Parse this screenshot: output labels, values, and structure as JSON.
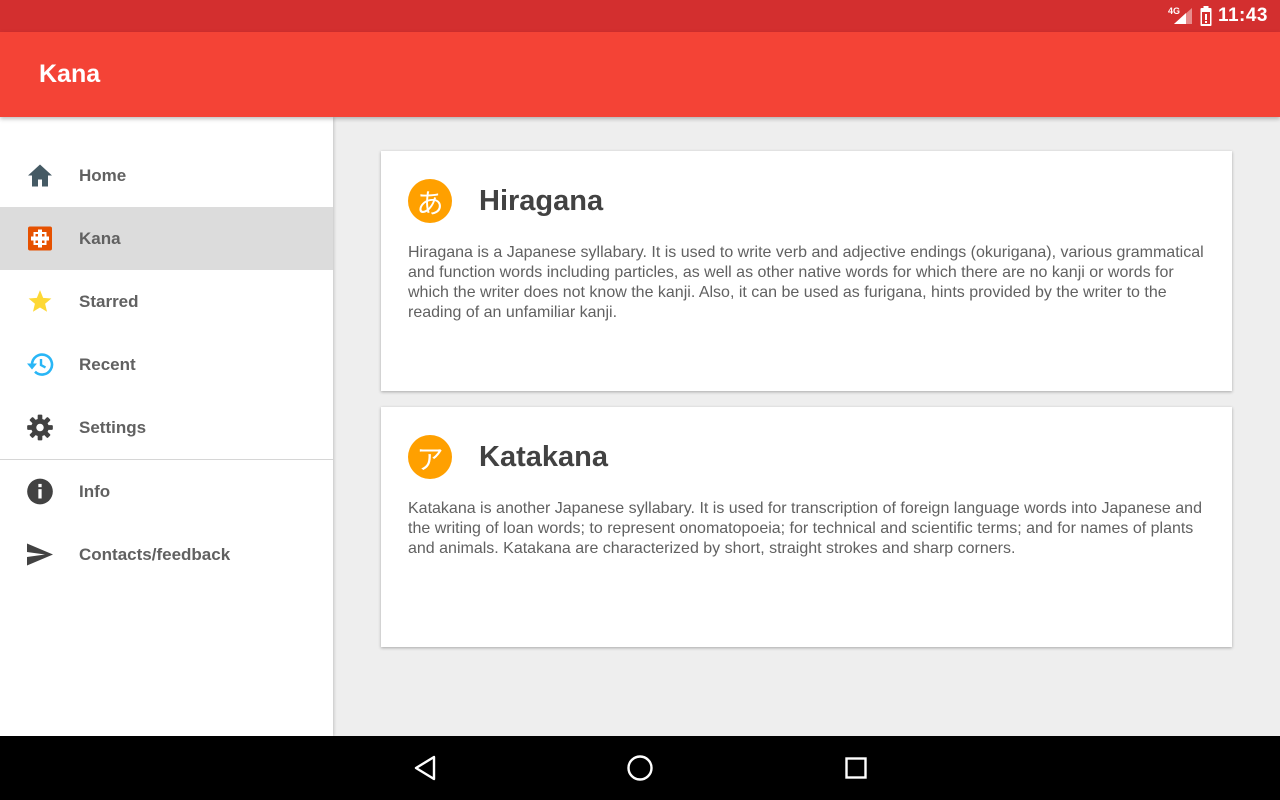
{
  "status_bar": {
    "network": "4G",
    "time": "11:43",
    "icons": [
      "signal-icon",
      "battery-icon"
    ]
  },
  "app_bar": {
    "title": "Kana"
  },
  "drawer": {
    "items": [
      {
        "label": "Home",
        "icon": "home-icon",
        "selected": false
      },
      {
        "label": "Kana",
        "icon": "kana-icon",
        "selected": true
      },
      {
        "label": "Starred",
        "icon": "star-icon",
        "selected": false
      },
      {
        "label": "Recent",
        "icon": "history-icon",
        "selected": false
      },
      {
        "label": "Settings",
        "icon": "gear-icon",
        "selected": false
      },
      {
        "label": "Info",
        "icon": "info-icon",
        "selected": false
      },
      {
        "label": "Contacts/feedback",
        "icon": "send-icon",
        "selected": false
      }
    ]
  },
  "cards": [
    {
      "badge": "あ",
      "title": "Hiragana",
      "body": "Hiragana is a Japanese syllabary. It is used to write verb and adjective endings (okurigana), various grammatical and function words including particles, as well as other native words for which there are no kanji or words for which the writer does not know the kanji. Also, it can be used as furigana, hints provided by the writer to the reading of an unfamiliar kanji."
    },
    {
      "badge": "ア",
      "title": "Katakana",
      "body": "Katakana is another Japanese syllabary. It is used for transcription of foreign language words into Japanese and the writing of loan words; to represent onomatopoeia; for technical and scientific terms; and for names of plants and animals. Katakana are characterized by short, straight strokes and sharp corners."
    }
  ],
  "system_nav": {
    "buttons": [
      "back-icon",
      "home-circle-icon",
      "overview-icon"
    ]
  },
  "colors": {
    "status_bar": "#d32f2f",
    "app_bar": "#f44336",
    "badge": "#ffa000",
    "selected_item": "#dcdcdc"
  }
}
